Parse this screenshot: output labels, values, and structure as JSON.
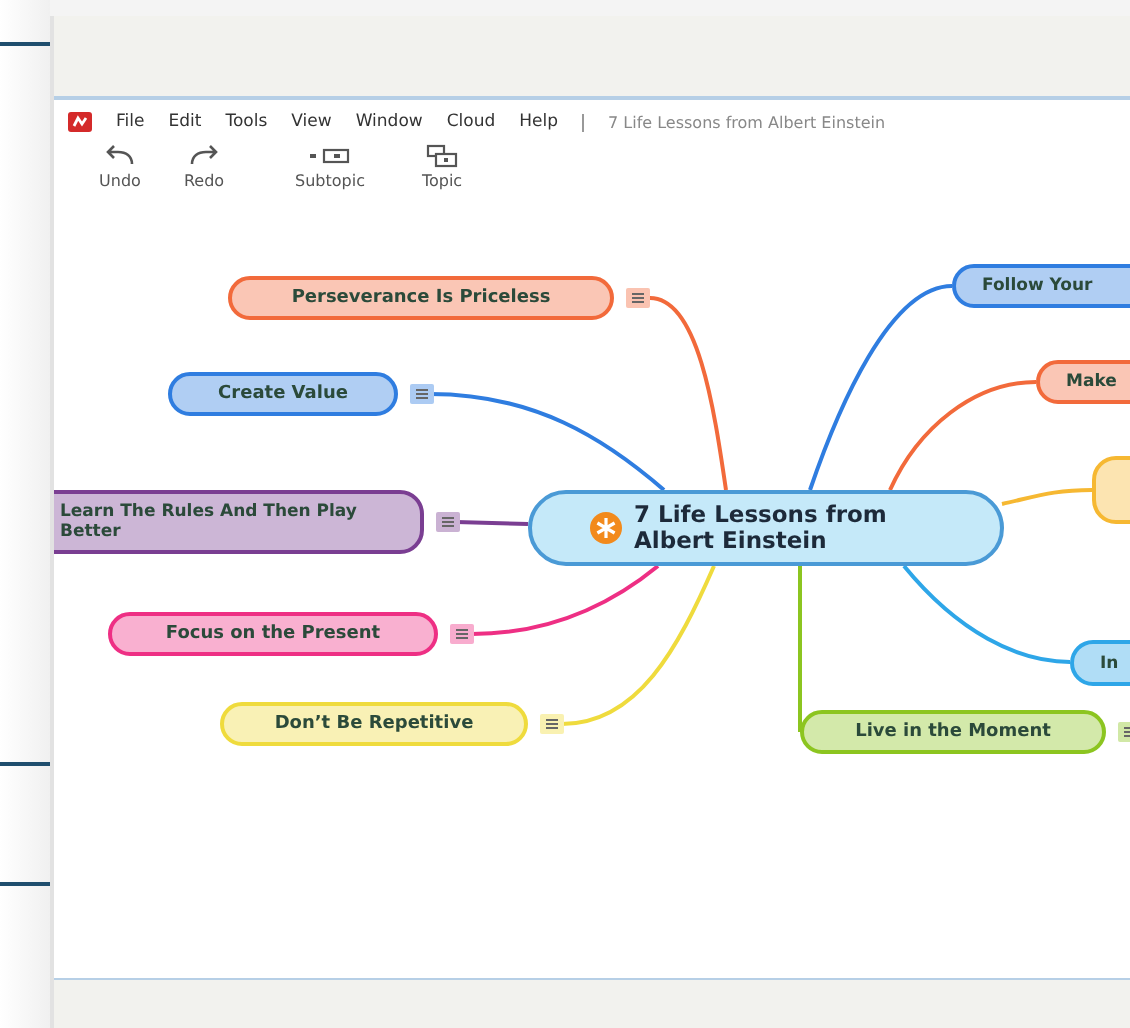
{
  "menu": [
    "File",
    "Edit",
    "Tools",
    "View",
    "Window",
    "Cloud",
    "Help"
  ],
  "document_title": "7 Life Lessons from Albert Einstein",
  "toolbar": [
    {
      "label": "Undo",
      "kind": "undo"
    },
    {
      "label": "Redo",
      "kind": "redo"
    },
    {
      "label": "Subtopic",
      "kind": "subtopic"
    },
    {
      "label": "Topic",
      "kind": "topic"
    }
  ],
  "central_topic": {
    "label": "7 Life Lessons from Albert Einstein"
  },
  "topics": [
    {
      "label": "Perseverance Is Priceless",
      "color": "#f26a3b",
      "has_note": true
    },
    {
      "label": "Create Value",
      "color": "#2f7de0",
      "has_note": true
    },
    {
      "label": "Learn The Rules And Then Play Better",
      "color": "#7a3e92",
      "has_note": true
    },
    {
      "label": "Focus on the Present",
      "color": "#ee2f84",
      "has_note": true
    },
    {
      "label": "Don’t Be Repetitive",
      "color": "#efdb3d",
      "has_note": true
    },
    {
      "label": "Follow Your",
      "color": "#2f7de0",
      "has_note": false
    },
    {
      "label": "Make",
      "color": "#f26a3b",
      "has_note": false
    },
    {
      "color": "#f6b832",
      "has_note": false
    },
    {
      "label": "In",
      "color": "#2ea6e8",
      "has_note": false
    },
    {
      "label": "Live in the Moment",
      "color": "#8cc520",
      "has_note": true
    }
  ]
}
